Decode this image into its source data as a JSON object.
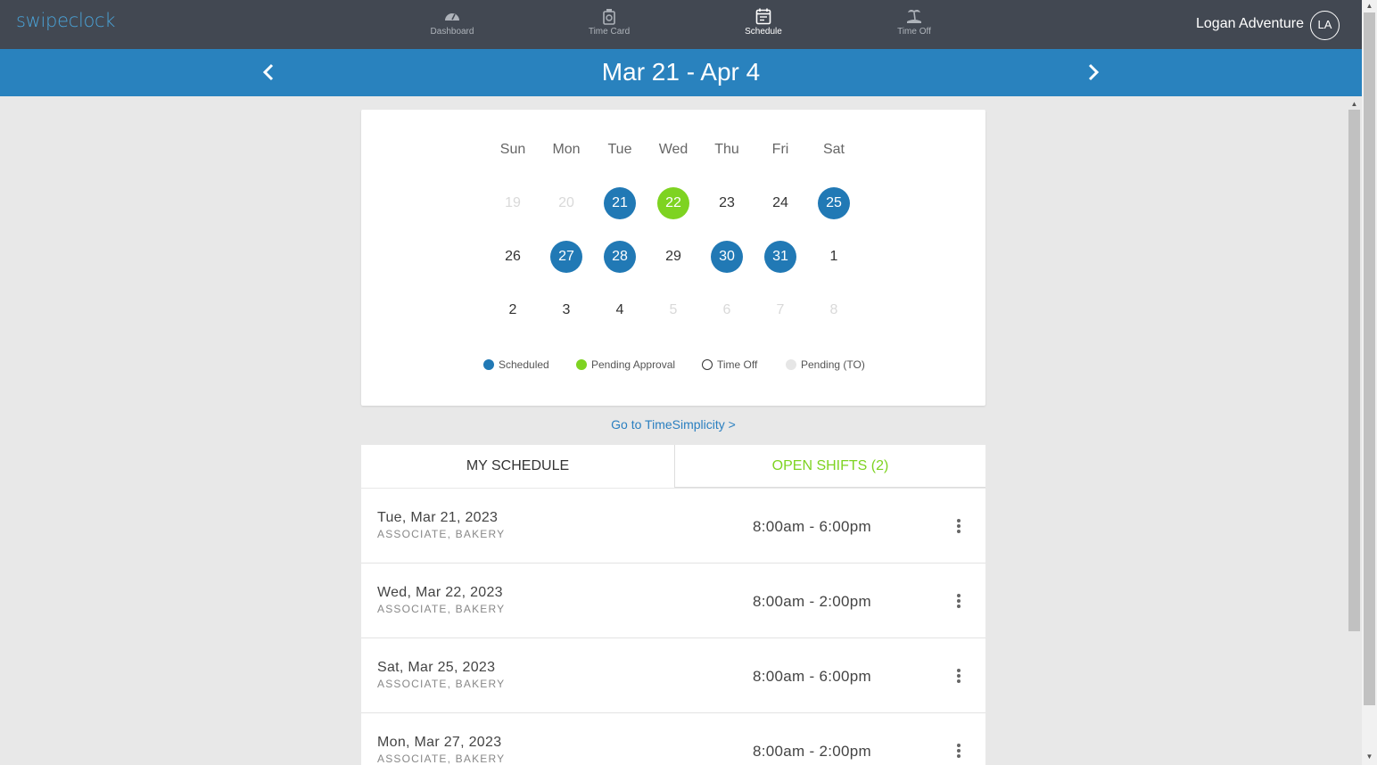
{
  "app": {
    "logo": "swipeclock"
  },
  "nav": [
    {
      "label": "Dashboard",
      "icon": "speedometer-icon",
      "active": false
    },
    {
      "label": "Time Card",
      "icon": "timecard-icon",
      "active": false
    },
    {
      "label": "Schedule",
      "icon": "calendar-icon",
      "active": true
    },
    {
      "label": "Time Off",
      "icon": "island-icon",
      "active": false
    }
  ],
  "user": {
    "name": "Logan Adventure",
    "initials": "LA"
  },
  "period": {
    "title": "Mar 21 - Apr 4"
  },
  "calendar": {
    "days_of_week": [
      "Sun",
      "Mon",
      "Tue",
      "Wed",
      "Thu",
      "Fri",
      "Sat"
    ],
    "weeks": [
      [
        {
          "d": "19",
          "s": "faded"
        },
        {
          "d": "20",
          "s": "faded"
        },
        {
          "d": "21",
          "s": "scheduled"
        },
        {
          "d": "22",
          "s": "pending"
        },
        {
          "d": "23",
          "s": "normal"
        },
        {
          "d": "24",
          "s": "normal"
        },
        {
          "d": "25",
          "s": "scheduled"
        }
      ],
      [
        {
          "d": "26",
          "s": "normal"
        },
        {
          "d": "27",
          "s": "scheduled"
        },
        {
          "d": "28",
          "s": "scheduled"
        },
        {
          "d": "29",
          "s": "normal"
        },
        {
          "d": "30",
          "s": "scheduled"
        },
        {
          "d": "31",
          "s": "scheduled"
        },
        {
          "d": "1",
          "s": "normal"
        }
      ],
      [
        {
          "d": "2",
          "s": "normal"
        },
        {
          "d": "3",
          "s": "normal"
        },
        {
          "d": "4",
          "s": "normal"
        },
        {
          "d": "5",
          "s": "faded"
        },
        {
          "d": "6",
          "s": "faded"
        },
        {
          "d": "7",
          "s": "faded"
        },
        {
          "d": "8",
          "s": "faded"
        }
      ]
    ],
    "legend": [
      {
        "label": "Scheduled",
        "color": "#2179b5"
      },
      {
        "label": "Pending Approval",
        "color": "#7ed321"
      },
      {
        "label": "Time Off",
        "color": "outline"
      },
      {
        "label": "Pending (TO)",
        "color": "#e6e6e6"
      }
    ]
  },
  "link": {
    "label": "Go to TimeSimplicity >"
  },
  "tabs": {
    "my": "MY SCHEDULE",
    "open": "OPEN SHIFTS (2)"
  },
  "shifts": [
    {
      "date": "Tue, Mar 21, 2023",
      "role": "ASSOCIATE, BAKERY",
      "time": "8:00am - 6:00pm"
    },
    {
      "date": "Wed, Mar 22, 2023",
      "role": "ASSOCIATE, BAKERY",
      "time": "8:00am - 2:00pm"
    },
    {
      "date": "Sat, Mar 25, 2023",
      "role": "ASSOCIATE, BAKERY",
      "time": "8:00am - 6:00pm"
    },
    {
      "date": "Mon, Mar 27, 2023",
      "role": "ASSOCIATE, BAKERY",
      "time": "8:00am - 2:00pm"
    }
  ],
  "colors": {
    "header": "#424852",
    "accent": "#2982be",
    "scheduled": "#2179b5",
    "pending": "#7ed321"
  }
}
